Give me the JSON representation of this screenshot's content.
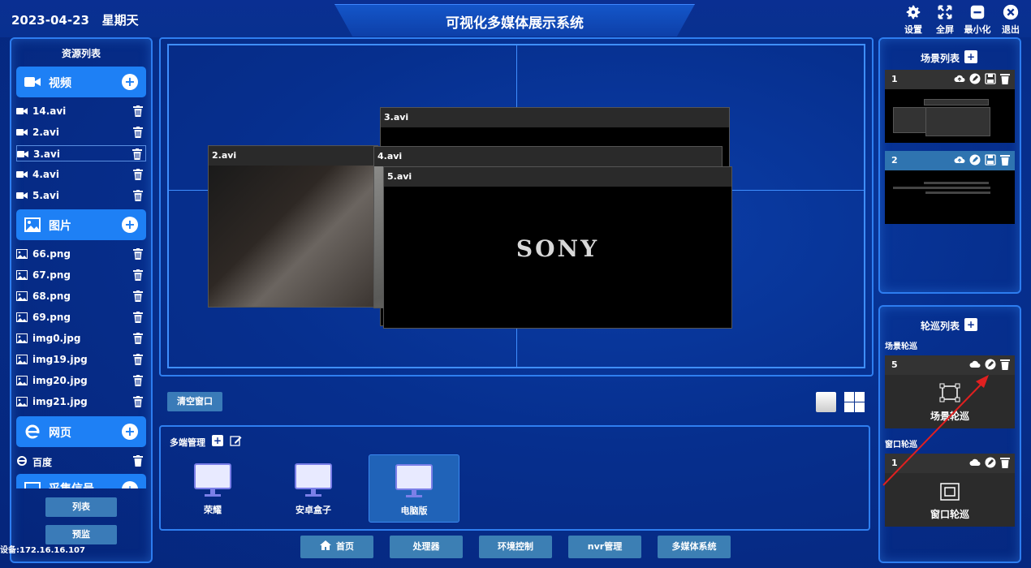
{
  "header": {
    "date": "2023-04-23",
    "weekday": "星期天",
    "title": "可视化多媒体展示系统",
    "buttons": [
      {
        "label": "设置",
        "icon": "gear-icon"
      },
      {
        "label": "全屏",
        "icon": "fullscreen-icon"
      },
      {
        "label": "最小化",
        "icon": "minimize-icon"
      },
      {
        "label": "退出",
        "icon": "close-icon"
      }
    ]
  },
  "resources": {
    "title": "资源列表",
    "video": {
      "label": "视频",
      "items": [
        "14.avi",
        "2.avi",
        "3.avi",
        "4.avi",
        "5.avi"
      ],
      "selected": "3.avi"
    },
    "image": {
      "label": "图片",
      "items": [
        "66.png",
        "67.png",
        "68.png",
        "69.png",
        "img0.jpg",
        "img19.jpg",
        "img20.jpg",
        "img21.jpg"
      ]
    },
    "web": {
      "label": "网页",
      "items": [
        "百度"
      ]
    },
    "capture": {
      "label": "采集信号"
    },
    "list_button": "列表",
    "preview_button": "预监",
    "device_text": "设备:172.16.16.107"
  },
  "canvas": {
    "windows": [
      {
        "title": "3.avi"
      },
      {
        "title": "2.avi"
      },
      {
        "title": "4.avi"
      },
      {
        "title": "5.avi",
        "content": "SONY"
      }
    ],
    "clear_button": "清空窗口"
  },
  "multi": {
    "title": "多端管理",
    "devices": [
      {
        "label": "荣耀",
        "selected": false
      },
      {
        "label": "安卓盒子",
        "selected": false
      },
      {
        "label": "电脑版",
        "selected": true
      }
    ]
  },
  "nav": [
    "首页",
    "处理器",
    "环境控制",
    "nvr管理",
    "多媒体系统"
  ],
  "scenes": {
    "title": "场景列表",
    "items": [
      {
        "id": "1"
      },
      {
        "id": "2"
      }
    ]
  },
  "tours": {
    "title": "轮巡列表",
    "scene_label": "场景轮巡",
    "scene_item": {
      "id": "5",
      "label": "场景轮巡"
    },
    "window_label": "窗口轮巡",
    "window_item": {
      "id": "1",
      "label": "窗口轮巡"
    }
  }
}
